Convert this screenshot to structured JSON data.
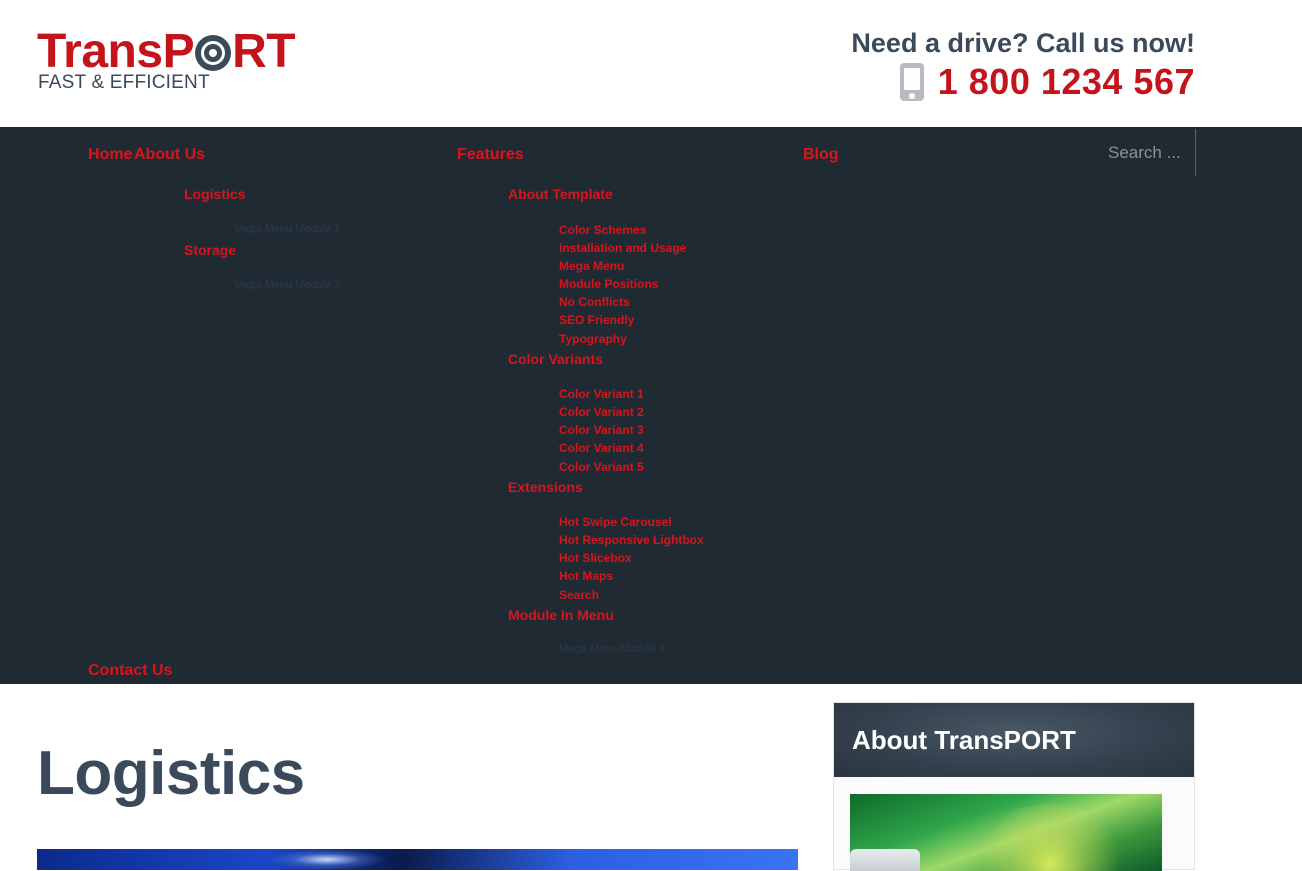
{
  "header": {
    "logo_main": "TransP",
    "logo_main_end": "RT",
    "logo_tagline": "FAST & EFFICIENT",
    "call_title": "Need a drive? Call us now!",
    "phone_number": "1 800 1234 567",
    "phone_icon": "mobile-phone-icon"
  },
  "nav": {
    "home": "Home",
    "about": "About Us",
    "features": "Features",
    "blog": "Blog",
    "contact": "Contact Us",
    "search_placeholder": "Search ...",
    "about_sub": {
      "logistics": "Logistics",
      "module1": "Mega Menu Module 1",
      "storage": "Storage",
      "module2": "Mega Menu Module 2"
    },
    "features_sub": {
      "about_template": "About Template",
      "about_template_items": [
        "Color Schemes",
        "Installation and Usage",
        "Mega Menu",
        "Module Positions",
        "No Conflicts",
        "SEO Friendly",
        "Typography"
      ],
      "color_variants": "Color Variants",
      "color_variant_items": [
        "Color Variant 1",
        "Color Variant 2",
        "Color Variant 3",
        "Color Variant 4",
        "Color Variant 5"
      ],
      "extensions": "Extensions",
      "extension_items": [
        "Hot Swipe Carousel",
        "Hot Responsive Lightbox",
        "Hot Slicebox",
        "Hot Maps",
        "Search"
      ],
      "module_in_menu": "Module In Menu",
      "module3": "Mega Menu Module 3"
    }
  },
  "main": {
    "page_title": "Logistics"
  },
  "sidebar": {
    "title": "About TransPORT"
  },
  "colors": {
    "brand_red": "#c4141b",
    "nav_bg": "#1f2a33",
    "heading_dark": "#3a4a5b"
  }
}
